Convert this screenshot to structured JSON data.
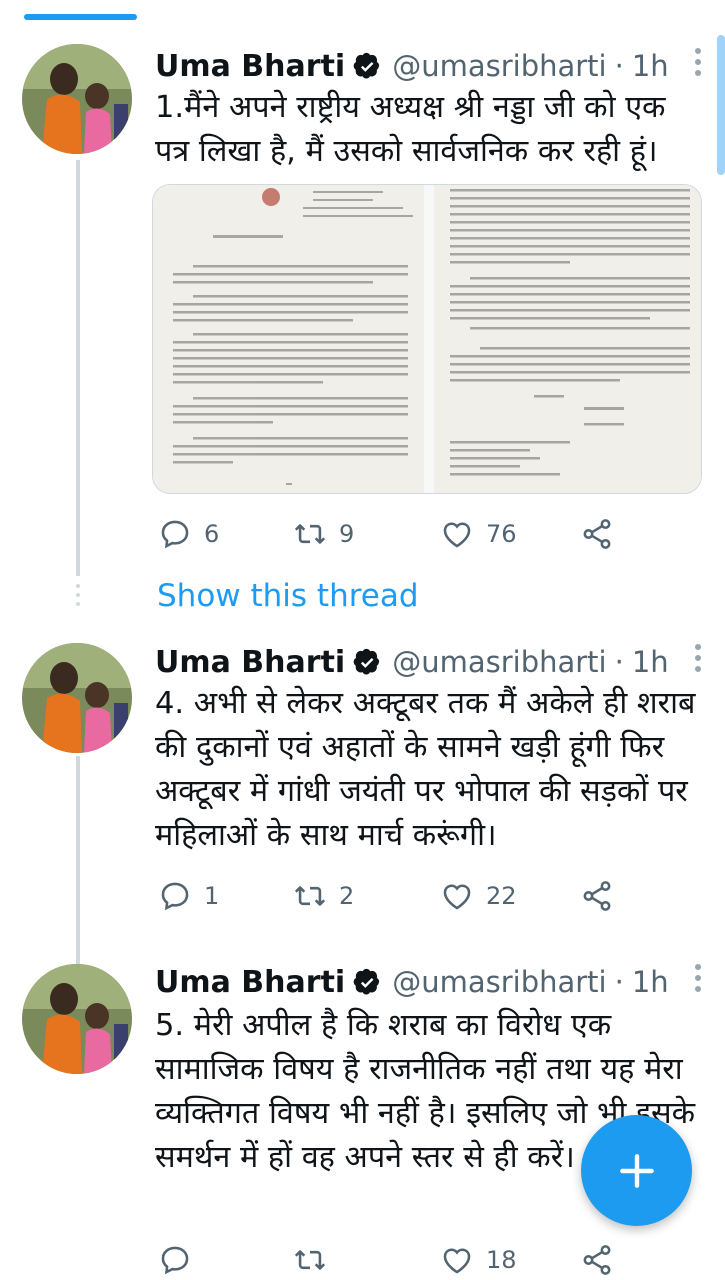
{
  "tweets": [
    {
      "author": "Uma Bharti",
      "handle": "@umasribharti",
      "time": "1h",
      "text": "1.मैंने अपने राष्ट्रीय अध्यक्ष श्री नड्डा जी को एक पत्र लिखा है, मैं उसको सार्वजनिक कर रही हूं।",
      "replies": "6",
      "retweets": "9",
      "likes": "76"
    },
    {
      "author": "Uma Bharti",
      "handle": "@umasribharti",
      "time": "1h",
      "text": "4. अभी से लेकर अक्टूबर तक मैं अकेले ही शराब की दुकानों एवं अहातों के सामने खड़ी हूंगी फिर अक्टूबर में गांधी जयंती पर भोपाल की सड़कों पर महिलाओं के साथ मार्च करूंगी।",
      "replies": "1",
      "retweets": "2",
      "likes": "22"
    },
    {
      "author": "Uma Bharti",
      "handle": "@umasribharti",
      "time": "1h",
      "text": "5. मेरी अपील है कि शराब का विरोध एक सामाजिक विषय है राजनीतिक नहीं तथा यह मेरा व्यक्तिगत विषय भी नहीं है। इसलिए जो भी इसके समर्थन में हों वह अपने स्तर से ही करें।",
      "replies": "",
      "retweets": "",
      "likes": "18"
    }
  ],
  "show_thread_label": "Show this thread",
  "colors": {
    "accent": "#1d9bf0",
    "text": "#0f1419",
    "muted": "#536471",
    "divider": "#cfd9de"
  },
  "icons": [
    "verified-badge-icon",
    "more-icon",
    "reply-icon",
    "retweet-icon",
    "like-icon",
    "share-icon",
    "compose-plus-icon"
  ]
}
